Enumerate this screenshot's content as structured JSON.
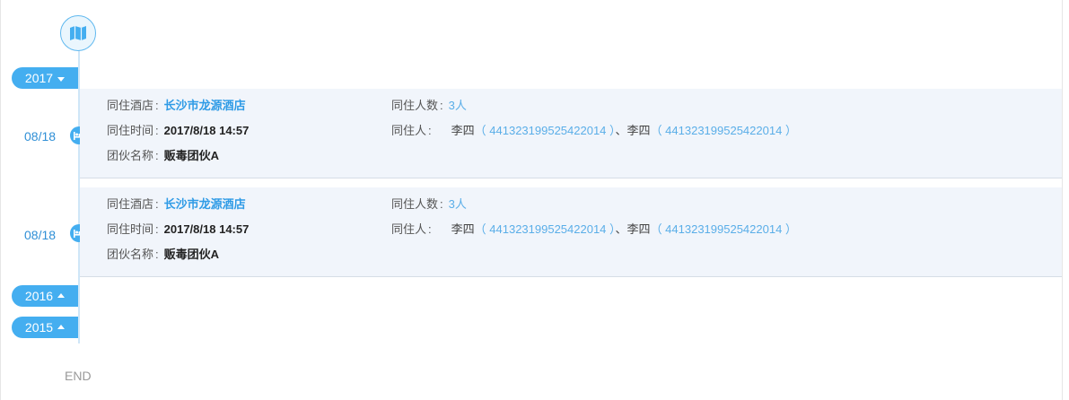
{
  "timeline": {
    "end_label": "END",
    "icon": "map-icon",
    "years": [
      {
        "label": "2017",
        "expanded": true
      },
      {
        "label": "2016",
        "expanded": false
      },
      {
        "label": "2015",
        "expanded": false
      }
    ],
    "records": [
      {
        "date": "08/18",
        "icon": "bed-icon",
        "hotel_label": "同住酒店",
        "hotel_value": "长沙市龙源酒店",
        "time_label": "同住时间",
        "time_value": "2017/8/18 14:57",
        "gang_label": "团伙名称",
        "gang_value": "贩毒团伙A",
        "count_label": "同住人数",
        "count_value": "3人",
        "people_label": "同住人",
        "people": [
          {
            "name": "李四",
            "id": "（ 441323199525422014 ）"
          },
          {
            "name": "李四",
            "id": "（ 441323199525422014 ）"
          }
        ],
        "people_sep": "、"
      },
      {
        "date": "08/18",
        "icon": "bed-icon",
        "hotel_label": "同住酒店",
        "hotel_value": "长沙市龙源酒店",
        "time_label": "同住时间",
        "time_value": "2017/8/18 14:57",
        "gang_label": "团伙名称",
        "gang_value": "贩毒团伙A",
        "count_label": "同住人数",
        "count_value": "3人",
        "people_label": "同住人",
        "people": [
          {
            "name": "李四",
            "id": "（ 441323199525422014 ）"
          },
          {
            "name": "李四",
            "id": "（ 441323199525422014 ）"
          }
        ],
        "people_sep": "、"
      }
    ]
  },
  "colors": {
    "accent": "#44aef0",
    "link": "#2f9be6",
    "card_bg": "#f1f5fb"
  }
}
